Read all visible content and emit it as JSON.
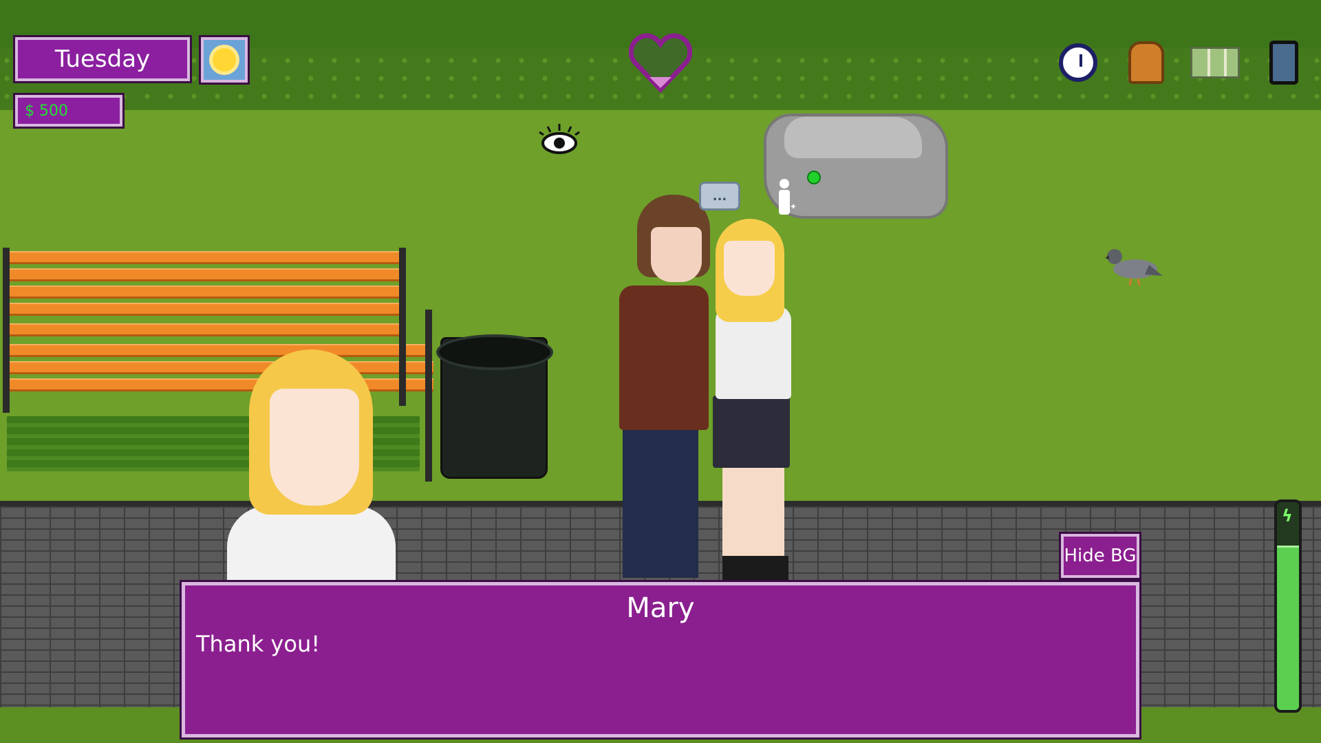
{
  "hud": {
    "day": "Tuesday",
    "weather_icon": "sun-icon",
    "money": "$ 500",
    "affection_icon": "heart-icon",
    "top_icons": [
      "clock-icon",
      "backpack-icon",
      "map-icon",
      "phone-icon"
    ]
  },
  "scene": {
    "speech_bubble": "...",
    "interact_icon": "eye-icon"
  },
  "dialog": {
    "speaker": "Mary",
    "text": "Thank you!",
    "hide_bg_label": "Hide BG"
  },
  "energy": {
    "level": 0.78,
    "icon": "lightning-icon"
  },
  "colors": {
    "panel": "#8b1f8f",
    "panel_border": "#d9b8e0",
    "money_text": "#22e033",
    "energy_fill": "#5bd050"
  }
}
